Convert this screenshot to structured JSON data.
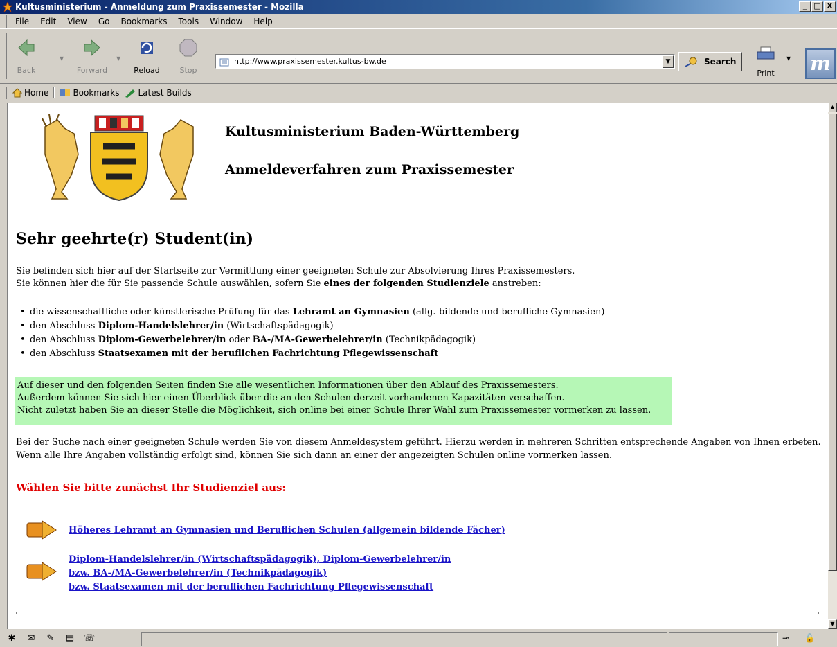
{
  "window": {
    "title": "Kultusministerium - Anmeldung zum Praxissemester - Mozilla",
    "minimize": "_",
    "maximize": "□",
    "close": "X"
  },
  "menubar": {
    "items": [
      "File",
      "Edit",
      "View",
      "Go",
      "Bookmarks",
      "Tools",
      "Window",
      "Help"
    ]
  },
  "navbar": {
    "back": "Back",
    "forward": "Forward",
    "reload": "Reload",
    "stop": "Stop",
    "url": "http://www.praxissemester.kultus-bw.de",
    "search": "Search",
    "print": "Print"
  },
  "personal_toolbar": {
    "home": "Home",
    "bookmarks": "Bookmarks",
    "latest_builds": "Latest Builds"
  },
  "page": {
    "heading_ministry": "Kultusministerium Baden-Württemberg",
    "heading_procedure": "Anmeldeverfahren zum Praxissemester",
    "greeting": "Sehr geehrte(r) Student(in)",
    "intro_line1": "Sie befinden sich hier auf der Startseite zur Vermittlung einer geeigneten Schule zur Absolvierung Ihres Praxissemesters.",
    "intro_line2_a": "Sie können hier die für Sie passende Schule auswählen, sofern Sie ",
    "intro_line2_b": "eines der folgenden Studienziele",
    "intro_line2_c": " anstreben:",
    "goals": [
      {
        "pre": "die wissenschaftliche oder künstlerische Prüfung für das ",
        "bold": "Lehramt an Gymnasien",
        "post": " (allg.-bildende und berufliche Gymnasien)"
      },
      {
        "pre": "den Abschluss ",
        "bold": "Diplom-Handelslehrer/in",
        "post": " (Wirtschaftspädagogik)"
      },
      {
        "pre": "den Abschluss ",
        "bold": "Diplom-Gewerbelehrer/in",
        "mid": " oder ",
        "bold2": "BA-/MA-Gewerbelehrer/in",
        "post": " (Technikpädagogik)"
      },
      {
        "pre": "den Abschluss ",
        "bold": "Staatsexamen mit der beruflichen Fachrichtung Pflegewissenschaft",
        "post": ""
      }
    ],
    "info_lines": [
      "Auf dieser und den folgenden Seiten finden Sie alle wesentlichen Informationen über den Ablauf des Praxissemesters.",
      "Außerdem können Sie sich hier einen Überblick über die an den Schulen derzeit vorhandenen Kapazitäten verschaffen.",
      "Nicht zuletzt haben Sie an dieser Stelle die Möglichkeit, sich online bei einer Schule Ihrer Wahl zum Praxissemester vormerken zu lassen."
    ],
    "search_text": "Bei der Suche nach einer geeigneten Schule werden Sie von diesem Anmeldesystem geführt. Hierzu werden in mehreren Schritten entsprechende Angaben von Ihnen erbeten. Wenn alle Ihre Angaben vollständig erfolgt sind, können Sie sich dann an einer der angezeigten Schulen online vormerken lassen.",
    "choose_prompt": "Wählen Sie bitte zunächst Ihr Studienziel aus:",
    "link1": "Höheres Lehramt an Gymnasien und Beruflichen Schulen (allgemein bildende Fächer)",
    "link2_lines": [
      "Diplom-Handelslehrer/in (Wirtschaftspädagogik), Diplom-Gewerbelehrer/in",
      "bzw. BA-/MA-Gewerbelehrer/in (Technikpädagogik)",
      "bzw. Staatsexamen mit der beruflichen Fachrichtung Pflegewissenschaft"
    ]
  },
  "colors": {
    "title_bar": "#0a246a",
    "info_box": "#b6f7b6",
    "prompt_red": "#e00000",
    "link_blue": "#1a14c8"
  }
}
